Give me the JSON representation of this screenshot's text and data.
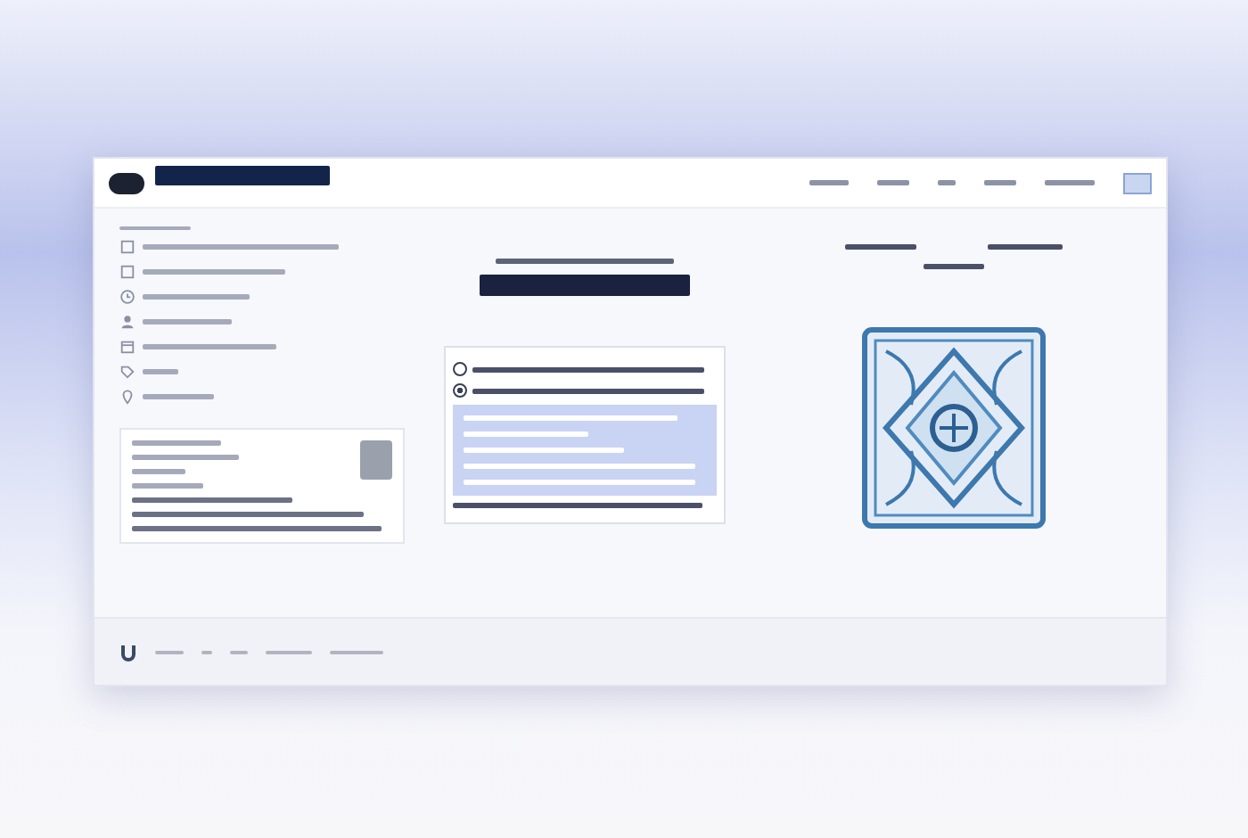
{
  "header": {
    "nav": [
      {
        "kind": "link"
      },
      {
        "kind": "link"
      },
      {
        "kind": "link"
      },
      {
        "kind": "link"
      },
      {
        "kind": "link"
      },
      {
        "kind": "button"
      }
    ]
  },
  "list": [
    {
      "kind": "checkbox"
    },
    {
      "kind": "checkbox"
    },
    {
      "kind": "clock"
    },
    {
      "kind": "person"
    },
    {
      "kind": "calendar"
    },
    {
      "kind": "tag"
    },
    {
      "kind": "pin"
    }
  ],
  "options": [
    {
      "selected": false
    },
    {
      "selected": true
    }
  ],
  "footer": {
    "links": [
      {
        "kind": "link"
      },
      {
        "kind": "link"
      },
      {
        "kind": "link"
      },
      {
        "kind": "link"
      },
      {
        "kind": "link"
      }
    ]
  }
}
